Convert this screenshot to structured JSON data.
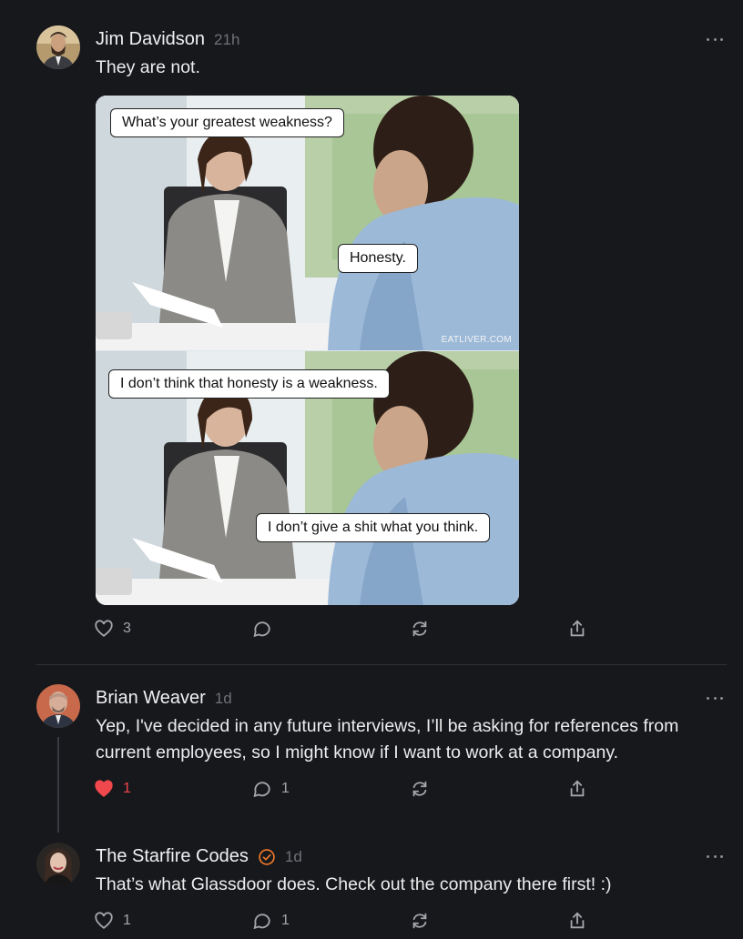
{
  "posts": [
    {
      "author": "Jim Davidson",
      "time": "21h",
      "text": "They are not.",
      "likes": "3",
      "replies": "",
      "liked": false,
      "image": {
        "bubbles": [
          "What’s your greatest weakness?",
          "Honesty.",
          "I don’t think that honesty is a weakness.",
          "I don’t give a shit what you think."
        ],
        "watermark": "EATLIVER.COM"
      }
    },
    {
      "author": "Brian Weaver",
      "time": "1d",
      "text": "Yep, I've decided in any future interviews, I’ll be asking for references from current employees, so I might know if I want to work at a company.",
      "likes": "1",
      "replies": "1",
      "liked": true
    },
    {
      "author": "The Starfire Codes",
      "verified": true,
      "time": "1d",
      "text": "That’s what Glassdoor does. Check out the company there first! :)",
      "likes": "1",
      "replies": "1",
      "liked": false
    }
  ],
  "colors": {
    "background": "#17181c",
    "like_active": "#f0484d",
    "verified": "#f07a2a",
    "muted": "#6f7177"
  },
  "icons": [
    "heart-icon",
    "comment-icon",
    "repost-icon",
    "share-icon",
    "more-icon",
    "verified-icon"
  ]
}
